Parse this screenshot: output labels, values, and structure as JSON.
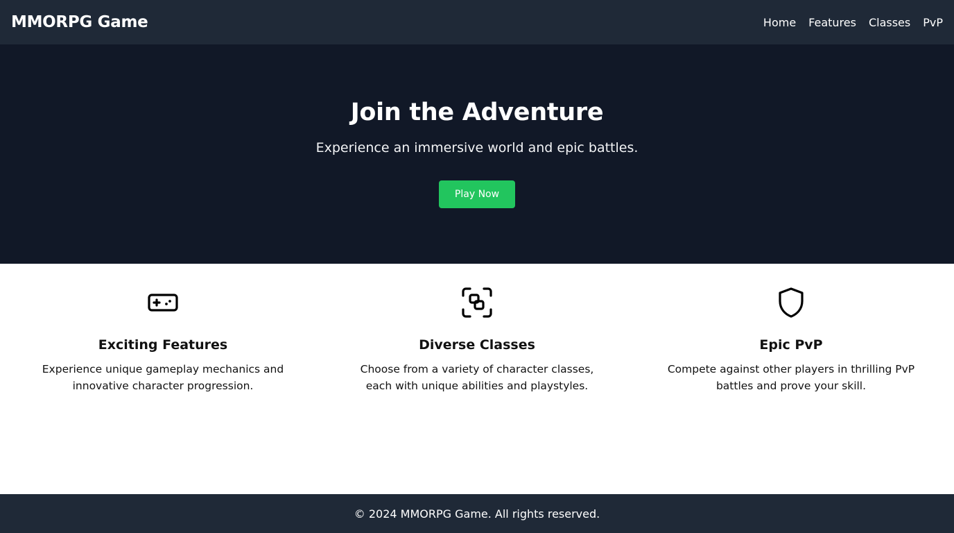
{
  "header": {
    "brand": "MMORPG Game",
    "nav": [
      "Home",
      "Features",
      "Classes",
      "PvP"
    ]
  },
  "hero": {
    "title": "Join the Adventure",
    "subtitle": "Experience an immersive world and epic battles.",
    "cta_label": "Play Now"
  },
  "features": [
    {
      "icon": "gamepad-icon",
      "title": "Exciting Features",
      "text": "Experience unique gameplay mechanics and innovative character progression."
    },
    {
      "icon": "classes-icon",
      "title": "Diverse Classes",
      "text": "Choose from a variety of character classes, each with unique abilities and playstyles."
    },
    {
      "icon": "shield-icon",
      "title": "Epic PvP",
      "text": "Compete against other players in thrilling PvP battles and prove your skill."
    }
  ],
  "footer": {
    "text": "© 2024 MMORPG Game. All rights reserved."
  },
  "colors": {
    "header_bg": "#1f2937",
    "hero_bg": "#111827",
    "accent": "#22c55e",
    "footer_bg": "#1f2937"
  }
}
